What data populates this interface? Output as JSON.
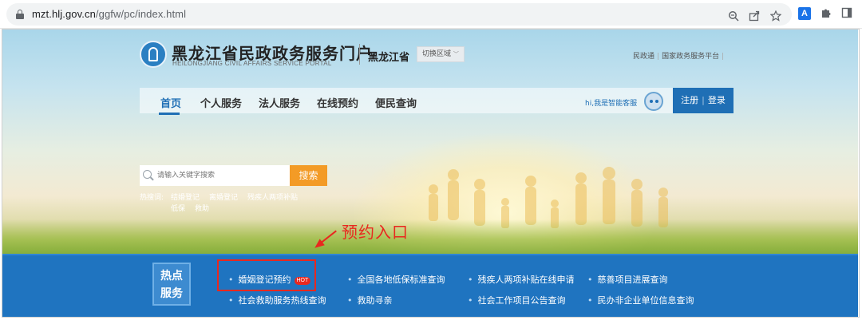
{
  "browser": {
    "url_host": "mzt.hlj.gov.cn",
    "url_path": "/ggfw/pc/index.html",
    "ext_label": "A"
  },
  "header": {
    "title": "黑龙江省民政政务服务门户",
    "subtitle": "HEILONGJIANG CIVIL AFFAIRS SERVICE PORTAL",
    "province": "黑龙江省",
    "switch_region": "切换区域",
    "top_links": [
      "民政通",
      "国家政务服务平台"
    ]
  },
  "nav": {
    "items": [
      "首页",
      "个人服务",
      "法人服务",
      "在线预约",
      "便民查询"
    ],
    "active_index": 0,
    "service_hint": "hi,我是智能客服",
    "register": "注册",
    "login": "登录"
  },
  "search": {
    "placeholder": "请输入关键字搜索",
    "button": "搜索",
    "hot_label": "热搜词:",
    "hot_keywords": [
      "结婚登记",
      "离婚登记",
      "残疾人两项补贴",
      "低保",
      "救助"
    ]
  },
  "annotation": {
    "text": "预约入口"
  },
  "hot_services": {
    "tile_line1": "热点",
    "tile_line2": "服务",
    "badge": "HOT",
    "items": [
      "婚姻登记预约",
      "全国各地低保标准查询",
      "残疾人两项补贴在线申请",
      "慈善项目进展查询",
      "社会救助服务热线查询",
      "救助寻亲",
      "社会工作项目公告查询",
      "民办非企业单位信息查询"
    ]
  },
  "colors": {
    "primary": "#1f6fb5",
    "band": "#1f74c0",
    "search_button": "#f39b26",
    "annotation": "#e8281f"
  }
}
